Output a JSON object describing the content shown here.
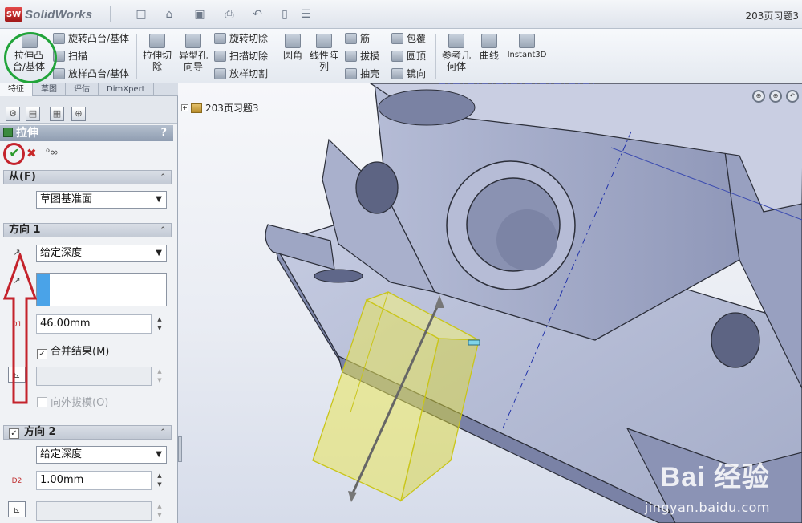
{
  "app": {
    "logo_text": "SolidWorks",
    "logo_badge": "SW",
    "document_title": "203页习题3"
  },
  "quick_access": {
    "icons": [
      "new-doc-icon",
      "open-icon",
      "save-icon",
      "print-icon",
      "undo-icon",
      "select-icon",
      "options-icon"
    ]
  },
  "ribbon": {
    "extrude_boss": "拉伸凸台/基体",
    "revolve_boss": "旋转凸台/基体",
    "sweep": "扫描",
    "loft": "放样凸台/基体",
    "extrude_cut": "拉伸切除",
    "hole_wizard": "异型孔向导",
    "revolve_cut": "旋转切除",
    "swept_cut": "扫描切除",
    "lofted_cut": "放样切割",
    "fillet": "圆角",
    "linear_pattern": "线性阵列",
    "rib": "筋",
    "draft": "拔模",
    "shell": "抽壳",
    "wrap": "包覆",
    "dome": "圆顶",
    "mirror": "镜向",
    "ref_geometry": "参考几何体",
    "curves": "曲线",
    "instant3d": "Instant3D"
  },
  "cm_tabs": [
    "特征",
    "草图",
    "评估",
    "DimXpert"
  ],
  "property_manager": {
    "title": "拉伸",
    "help": "?",
    "from_group": {
      "label": "从(F)",
      "value": "草图基准面"
    },
    "direction1": {
      "label": "方向 1",
      "end_condition": "给定深度",
      "depth_label": "D1",
      "depth": "46.00mm",
      "merge_label": "合并结果(M)",
      "merge_checked": "✓",
      "draft_outward_label": "向外拔模(O)"
    },
    "direction2": {
      "label": "方向 2",
      "checked": "✓",
      "end_condition": "给定深度",
      "depth_label": "D2",
      "depth": "1.00mm"
    }
  },
  "viewport": {
    "tree_node": "203页习题3",
    "watermark": "Bai  经验",
    "watermark_url": "jingyan.baidu.com"
  },
  "colors": {
    "annotation_green": "#21a43a",
    "annotation_red": "#c4232c",
    "preview_yellow": "#e8e44a",
    "model_gray": "#9aa3c2"
  }
}
